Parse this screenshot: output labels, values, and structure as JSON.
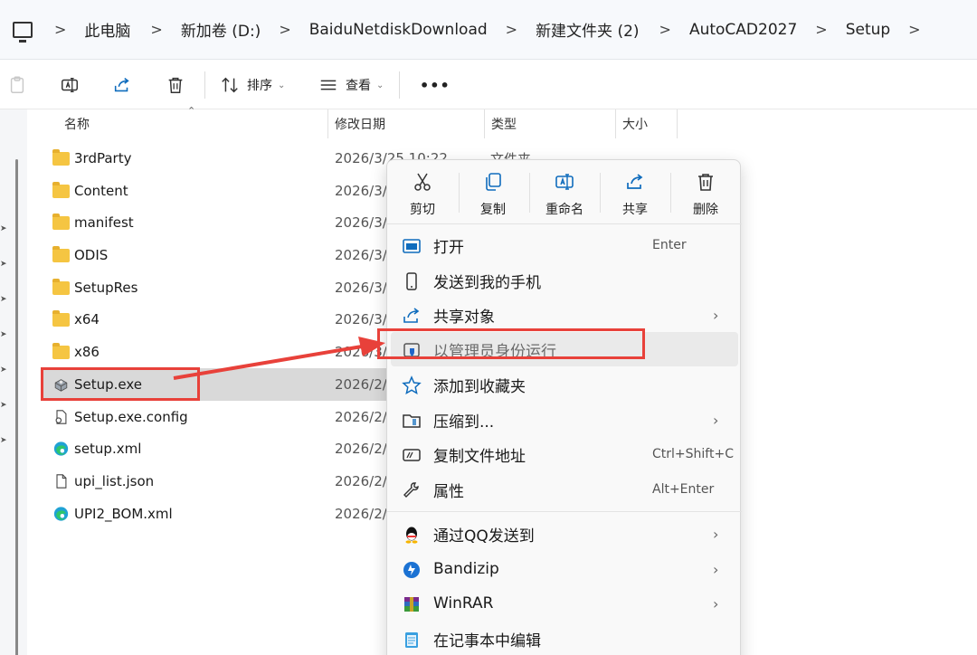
{
  "breadcrumb": {
    "items": [
      "此电脑",
      "新加卷 (D:)",
      "BaiduNetdiskDownload",
      "新建文件夹 (2)",
      "AutoCAD2027",
      "Setup"
    ],
    "separator": ">"
  },
  "toolbar": {
    "sort_label": "排序",
    "view_label": "查看",
    "more_label": "•••"
  },
  "columns": {
    "name": "名称",
    "date": "修改日期",
    "type": "类型",
    "size": "大小"
  },
  "files": [
    {
      "name": "3rdParty",
      "date": "2026/3/25 10:22",
      "type": "文件夹",
      "icon": "folder-icon"
    },
    {
      "name": "Content",
      "date": "2026/3/",
      "icon": "folder-icon"
    },
    {
      "name": "manifest",
      "date": "2026/3/",
      "icon": "folder-icon"
    },
    {
      "name": "ODIS",
      "date": "2026/3/",
      "icon": "folder-icon"
    },
    {
      "name": "SetupRes",
      "date": "2026/3/",
      "icon": "folder-icon"
    },
    {
      "name": "x64",
      "date": "2026/3/",
      "icon": "folder-icon"
    },
    {
      "name": "x86",
      "date": "2026/3/",
      "icon": "folder-icon"
    },
    {
      "name": "Setup.exe",
      "date": "2026/2/",
      "icon": "installer-icon",
      "selected": true
    },
    {
      "name": "Setup.exe.config",
      "date": "2026/2/",
      "icon": "config-file-icon"
    },
    {
      "name": "setup.xml",
      "date": "2026/2/",
      "icon": "edge-icon"
    },
    {
      "name": "upi_list.json",
      "date": "2026/2/",
      "icon": "file-icon"
    },
    {
      "name": "UPI2_BOM.xml",
      "date": "2026/2/",
      "icon": "edge-icon"
    }
  ],
  "context_menu": {
    "quick_actions": [
      "剪切",
      "复制",
      "重命名",
      "共享",
      "删除"
    ],
    "items": [
      {
        "label": "打开",
        "shortcut": "Enter",
        "icon": "open-icon"
      },
      {
        "label": "发送到我的手机",
        "icon": "phone-icon"
      },
      {
        "label": "共享对象",
        "submenu": true,
        "icon": "share-icon"
      },
      {
        "label": "以管理员身份运行",
        "icon": "shield-icon",
        "highlighted": true
      },
      {
        "label": "添加到收藏夹",
        "icon": "star-icon"
      },
      {
        "label": "压缩到...",
        "submenu": true,
        "icon": "zip-icon"
      },
      {
        "label": "复制文件地址",
        "shortcut": "Ctrl+Shift+C",
        "icon": "copy-path-icon"
      },
      {
        "label": "属性",
        "shortcut": "Alt+Enter",
        "icon": "wrench-icon"
      },
      {
        "label": "通过QQ发送到",
        "submenu": true,
        "icon": "qq-icon"
      },
      {
        "label": "Bandizip",
        "submenu": true,
        "icon": "bandizip-icon"
      },
      {
        "label": "WinRAR",
        "submenu": true,
        "icon": "winrar-icon"
      },
      {
        "label": "在记事本中编辑",
        "icon": "notepad-icon"
      }
    ],
    "chevron": "›"
  },
  "colors": {
    "annotation": "#e8413a",
    "folder": "#f5c542",
    "accent": "#0f6cbd"
  }
}
